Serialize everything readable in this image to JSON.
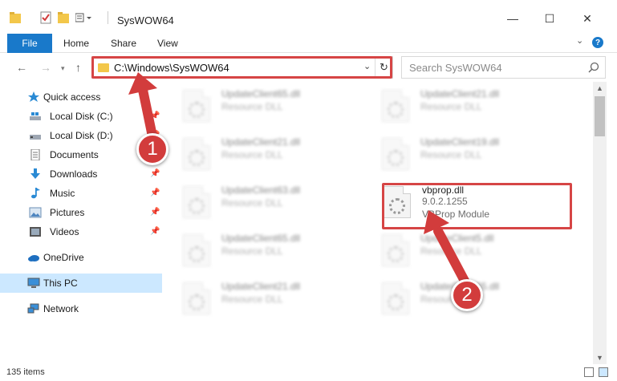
{
  "window": {
    "title": "SysWOW64",
    "minimize": "—",
    "maximize": "☐",
    "close": "✕"
  },
  "ribbon": {
    "tabs": [
      "File",
      "Home",
      "Share",
      "View"
    ],
    "help": "?"
  },
  "address": {
    "path": "C:\\Windows\\SysWOW64",
    "search_placeholder": "Search SysWOW64"
  },
  "nav_pane": {
    "items": [
      {
        "label": "Quick access",
        "icon": "star-icon"
      },
      {
        "label": "Local Disk (C:)",
        "icon": "drive-icon",
        "pinned": true
      },
      {
        "label": "Local Disk (D:)",
        "icon": "drive-icon",
        "pinned": true
      },
      {
        "label": "Documents",
        "icon": "documents-icon",
        "pinned": true
      },
      {
        "label": "Downloads",
        "icon": "download-icon",
        "pinned": true
      },
      {
        "label": "Music",
        "icon": "music-icon",
        "pinned": true
      },
      {
        "label": "Pictures",
        "icon": "pictures-icon",
        "pinned": true
      },
      {
        "label": "Videos",
        "icon": "videos-icon",
        "pinned": true
      },
      {
        "label": "OneDrive",
        "icon": "cloud-icon"
      },
      {
        "label": "This PC",
        "icon": "computer-icon",
        "selected": true
      },
      {
        "label": "Network",
        "icon": "network-icon"
      }
    ]
  },
  "files": [
    {
      "name": "UpdateClient65.dll",
      "desc": "Resource DLL"
    },
    {
      "name": "UpdateClient21.dll",
      "desc": "Resource DLL"
    },
    {
      "name": "UpdateClient21.dll",
      "desc": "Resource DLL"
    },
    {
      "name": "UpdateClient19.dll",
      "desc": "Resource DLL"
    },
    {
      "name": "UpdateClient63.dll",
      "desc": "Resource DLL"
    },
    {
      "name": "vbprop.dll",
      "version": "9.0.2.1255",
      "desc": "VBProp Module"
    },
    {
      "name": "UpdateClient65.dll",
      "desc": "Resource DLL"
    },
    {
      "name": "UpdateClient5.dll",
      "desc": "Resource DLL"
    },
    {
      "name": "UpdateClient21.dll",
      "desc": "Resource DLL"
    },
    {
      "name": "UpdateClient65.dll",
      "desc": "Resource DLL"
    }
  ],
  "status": {
    "item_count": "135 items"
  },
  "callouts": {
    "step1": "1",
    "step2": "2",
    "color": "#d23c3c"
  }
}
